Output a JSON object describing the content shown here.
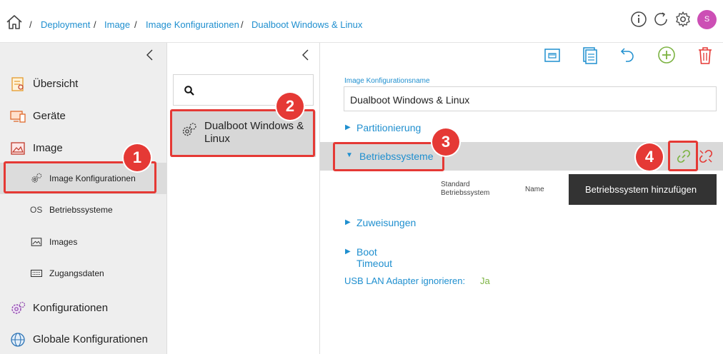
{
  "breadcrumb": {
    "sep": "/",
    "items": [
      "Deployment",
      "Image",
      "Image Konfigurationen",
      "Dualboot Windows & Linux"
    ]
  },
  "user": {
    "avatar_initial": "S"
  },
  "sidebar": {
    "main_items": [
      {
        "label": "Übersicht",
        "icon": "overview-icon"
      },
      {
        "label": "Geräte",
        "icon": "devices-icon"
      },
      {
        "label": "Image",
        "icon": "image-icon"
      },
      {
        "label": "Konfigurationen",
        "icon": "configurations-icon"
      },
      {
        "label": "Globale Konfigurationen",
        "icon": "global-configurations-icon"
      }
    ],
    "sub_items": [
      {
        "label": "Image Konfigurationen",
        "icon": "gears-icon",
        "active": true
      },
      {
        "label": "Betriebssysteme",
        "icon_text": "OS"
      },
      {
        "label": "Images",
        "icon": "picture-icon"
      },
      {
        "label": "Zugangsdaten",
        "icon": "keyboard-icon"
      }
    ]
  },
  "list": {
    "search_placeholder": "",
    "items": [
      {
        "label": "Dualboot Windows & Linux"
      }
    ]
  },
  "detail": {
    "name_label": "Image Konfigurationsname",
    "name_value": "Dualboot Windows & Linux",
    "sections": {
      "partitioning": "Partitionierung",
      "operating_systems": "Betriebssysteme",
      "assignments": "Zuweisungen",
      "boot_timeout": "Boot Timeout"
    },
    "table_headers": {
      "default_os": "Standard Betriebssystem",
      "name": "Name"
    },
    "tooltip": "Betriebssystem hinzufügen",
    "usb_label": "USB LAN Adapter ignorieren:",
    "usb_value": "Ja"
  },
  "annotations": [
    "1",
    "2",
    "3",
    "4"
  ],
  "colors": {
    "link_blue": "#1f8fcf",
    "annotation_red": "#e53935",
    "add_green": "#7cb342",
    "delete_red": "#e53935",
    "avatar": "#cc4fb5"
  }
}
